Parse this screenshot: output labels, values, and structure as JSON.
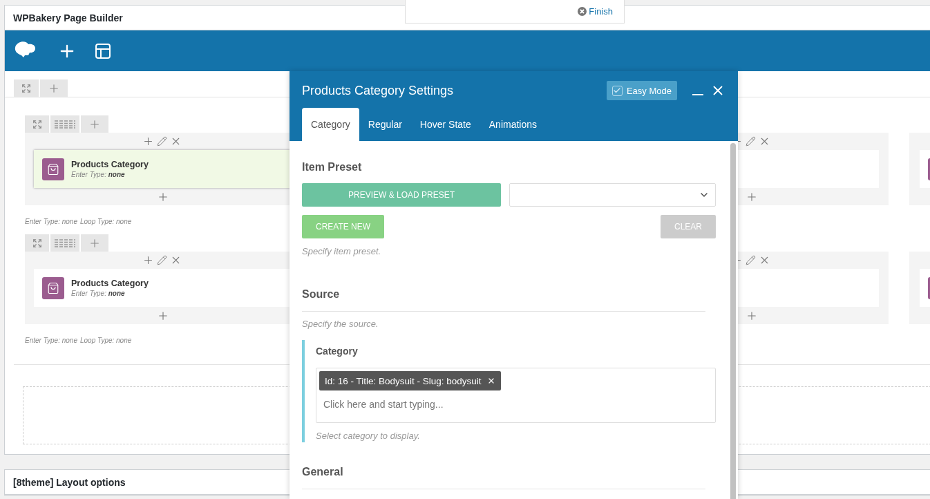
{
  "finish_popup": {
    "label": "Finish"
  },
  "builder": {
    "title": "WPBakery Page Builder",
    "inner_rows": [
      {
        "columns": [
          {
            "kind": "element",
            "highlighted": true,
            "title": "Products Category",
            "subtitle": "Enter Type: **none**"
          },
          {
            "kind": "covered"
          },
          {
            "kind": "edge"
          }
        ],
        "meta": [
          "Enter Type: none",
          "Loop Type: none"
        ]
      },
      {
        "columns": [
          {
            "kind": "element",
            "highlighted": false,
            "title": "Products Category",
            "subtitle": "Enter Type: **none**"
          },
          {
            "kind": "covered"
          },
          {
            "kind": "edge"
          }
        ],
        "meta": [
          "Enter Type: none",
          "Loop Type: none"
        ]
      }
    ]
  },
  "modal": {
    "title": "Products Category Settings",
    "easy_mode": {
      "label": "Easy Mode",
      "checked": true
    },
    "tabs": [
      {
        "label": "Category",
        "selected": true
      },
      {
        "label": "Regular",
        "selected": false
      },
      {
        "label": "Hover State",
        "selected": false
      },
      {
        "label": "Animations",
        "selected": false
      }
    ],
    "sections": [
      {
        "kind": "preset",
        "heading": "Item Preset",
        "buttons": [
          {
            "kind": "preview",
            "label": "PREVIEW & LOAD PRESET",
            "disabled": false
          },
          {
            "kind": "create",
            "label": "CREATE NEW",
            "disabled": false
          },
          {
            "kind": "clear",
            "label": "CLEAR",
            "disabled": true
          }
        ],
        "hint": "Specify item preset."
      },
      {
        "kind": "source",
        "heading": "Source",
        "hint": "Specify the source.",
        "field": {
          "label": "Category",
          "tags": [
            "Id: 16 - Title: Bodysuit - Slug: bodysuit"
          ],
          "placeholder": "Click here and start typing...",
          "hint": "Select category to display."
        }
      },
      {
        "kind": "general",
        "heading": "General"
      }
    ]
  },
  "layout_options": {
    "title": "[8theme] Layout options"
  }
}
